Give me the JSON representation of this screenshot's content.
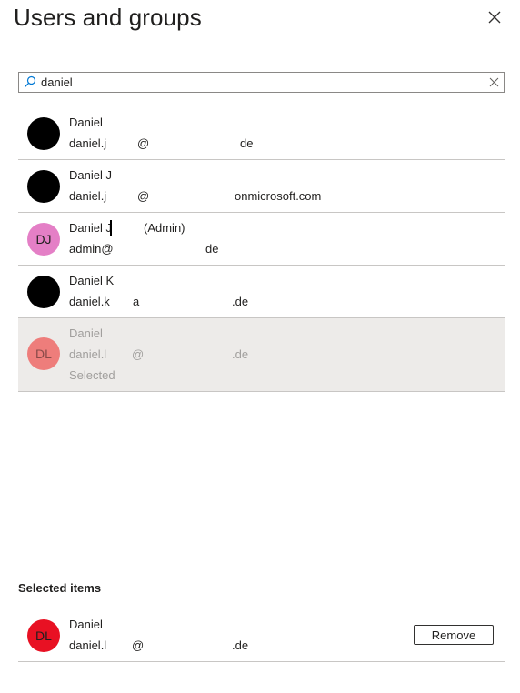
{
  "panel": {
    "title": "Users and groups"
  },
  "search": {
    "value": "daniel"
  },
  "results": [
    {
      "initials": "",
      "avatar_style": "redacted",
      "name": "Daniel",
      "email_parts": [
        "daniel.j",
        "@",
        "de"
      ]
    },
    {
      "initials": "",
      "avatar_style": "redacted",
      "name": "Daniel J",
      "email_parts": [
        "daniel.j",
        "@",
        "onmicrosoft.com"
      ]
    },
    {
      "initials": "DJ",
      "avatar_style": "pink",
      "name": "Daniel J",
      "name_suffix": "(Admin)",
      "email_parts": [
        "admin@",
        "",
        "de"
      ]
    },
    {
      "initials": "",
      "avatar_style": "redacted",
      "name": "Daniel K",
      "email_parts": [
        "daniel.k",
        "a",
        ".de"
      ]
    },
    {
      "initials": "DL",
      "avatar_style": "salmon",
      "name": "Daniel",
      "email_parts": [
        "daniel.l",
        "@",
        ".de"
      ],
      "status": "Selected"
    }
  ],
  "selected_section": {
    "label": "Selected items",
    "items": [
      {
        "initials": "DL",
        "avatar_style": "red",
        "name": "Daniel",
        "email_parts": [
          "daniel.l",
          "@",
          ".de"
        ],
        "remove_label": "Remove"
      }
    ]
  },
  "colors": {
    "border": "#c8c6c4",
    "selected_bg": "#edebe9",
    "pink_avatar": "#e47fc6",
    "salmon_avatar": "#ee7d7b",
    "red_avatar": "#e81123"
  },
  "icons": {
    "close": "close-icon",
    "search": "search-icon",
    "clear": "clear-icon"
  }
}
